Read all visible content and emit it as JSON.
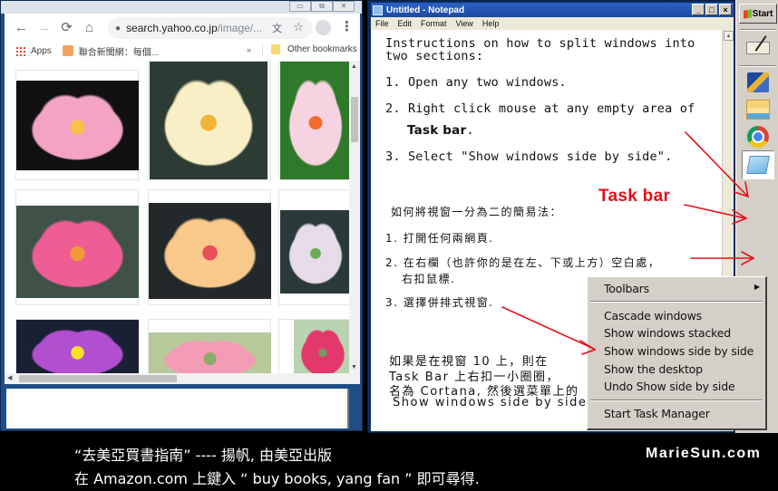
{
  "browser": {
    "caption_buttons": [
      "minimize",
      "restore",
      "close"
    ],
    "nav": {
      "back_icon": "←",
      "forward_icon": "→",
      "reload_icon": "⟳",
      "home_icon": "⌂"
    },
    "address": {
      "lock_icon": "🔒",
      "host": "search.yahoo.co.jp",
      "path": "/image/...",
      "translate_icon": "文",
      "star_icon": "☆"
    },
    "menu_icon": "⋮",
    "bookmarks": {
      "apps_label": "Apps",
      "items": [
        {
          "label": "聯合新聞網：每個..."
        }
      ],
      "more": "»",
      "other_label": "Other bookmarks"
    },
    "images": [
      {
        "desc": "pink water lily on black",
        "colors": [
          "#111",
          "#f3a3c4",
          "#f6c24a"
        ]
      },
      {
        "desc": "cream yellow water lily",
        "colors": [
          "#2c3b33",
          "#f9efc6",
          "#f3b43a"
        ]
      },
      {
        "desc": "light pink water lily",
        "colors": [
          "#2f7a2a",
          "#f7d3e1",
          "#f36a2a"
        ]
      },
      {
        "desc": "hot pink water lily",
        "colors": [
          "#3e5248",
          "#ee5d93",
          "#f29a3a"
        ]
      },
      {
        "desc": "peach yellow water lily",
        "colors": [
          "#23292a",
          "#f8c98a",
          "#e84d5a"
        ]
      },
      {
        "desc": "white lavender water lily",
        "colors": [
          "#2a3a3a",
          "#e5dbe9",
          "#6aaa5a"
        ]
      },
      {
        "desc": "purple water lily",
        "colors": [
          "#1a2033",
          "#b24fd1",
          "#f9e12a"
        ]
      },
      {
        "desc": "pink lily on lily pads",
        "colors": [
          "#b7c99a",
          "#f39ab5",
          "#8aaa6a"
        ]
      },
      {
        "desc": "magenta lily",
        "colors": [
          "#b9d3b0",
          "#e3386c",
          "#6f9c64"
        ]
      }
    ]
  },
  "notepad": {
    "title": "Untitled - Notepad",
    "caption_buttons": [
      "_",
      "□",
      "×"
    ],
    "menu": [
      "File",
      "Edit",
      "Format",
      "View",
      "Help"
    ],
    "english": {
      "heading_line1": "Instructions on how to split windows into",
      "heading_line2": "two sections:",
      "step1": "1. Open any two windows.",
      "step2_line1": "2. Right click mouse at any empty area of",
      "step2_line2": "Task bar",
      "step2_line2_suffix": ".",
      "step3": "3. Select \"Show windows side by side\"."
    },
    "chinese": {
      "heading": "如何將視窗一分為二的簡易法：",
      "step1": "1. 打開任何兩網頁.",
      "step2_line1": "2. 在右欄（也許你的是在左、下或上方）空白處，",
      "step2_line2": "右扣鼠標.",
      "step3": "3. 選擇併排式視窗.",
      "note_line1": "如果是在視窗 10 上，則在",
      "note_line2": "Task Bar 上右扣一小圈圈，",
      "note_line3": "名為 Cortana, 然後選菜單上的",
      "note_line4": "Show windows side by side."
    },
    "annotation": "Task bar"
  },
  "taskbar": {
    "start_label": "Start",
    "icons": [
      {
        "name": "signature-tool"
      },
      {
        "name": "remote-desktop"
      },
      {
        "name": "file-explorer"
      },
      {
        "name": "chrome"
      },
      {
        "name": "notepad",
        "active": true
      }
    ]
  },
  "context_menu": {
    "toolbars": "Toolbars",
    "submenu_arrow": "▶",
    "items": [
      "Cascade windows",
      "Show windows stacked",
      "Show windows side by side",
      "Show the desktop",
      "Undo Show side by side"
    ],
    "task_manager": "Start Task Manager"
  },
  "footer": {
    "line1": "“去美亞買書指南” ---- 揚帆,  由美亞出版",
    "line2": "在 Amazon.com 上鍵入 “ buy books, yang fan ”  即可尋得.",
    "site": "MarieSun.com"
  },
  "colors": {
    "annotation_red": "#e4101b",
    "notepad_title": "#1c4aa4",
    "classic_gray": "#d4d0c8"
  }
}
